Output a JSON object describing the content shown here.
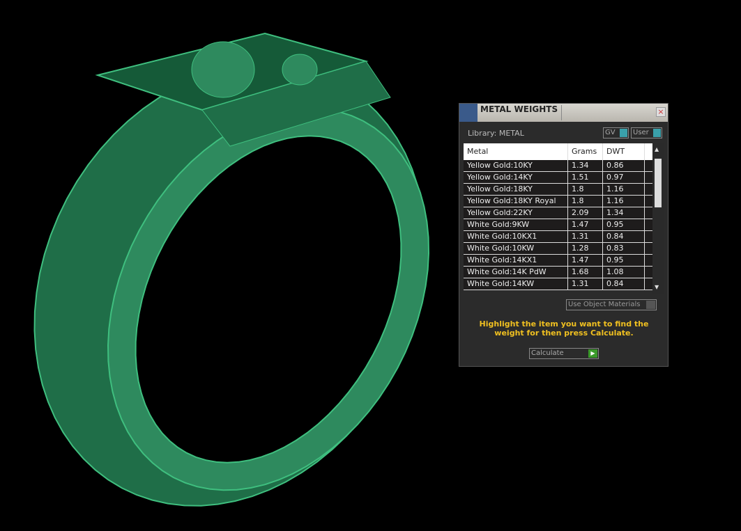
{
  "panel": {
    "title": "METAL WEIGHTS",
    "library_label": "Library: METAL",
    "toggles": [
      {
        "label": "GV"
      },
      {
        "label": "User"
      }
    ],
    "columns": [
      "Metal",
      "Grams",
      "DWT"
    ],
    "rows": [
      [
        "Yellow Gold:10KY",
        "1.34",
        "0.86"
      ],
      [
        "Yellow Gold:14KY",
        "1.51",
        "0.97"
      ],
      [
        "Yellow Gold:18KY",
        "1.8",
        "1.16"
      ],
      [
        "Yellow Gold:18KY Royal",
        "1.8",
        "1.16"
      ],
      [
        "Yellow Gold:22KY",
        "2.09",
        "1.34"
      ],
      [
        "White Gold:9KW",
        "1.47",
        "0.95"
      ],
      [
        "White Gold:10KX1",
        "1.31",
        "0.84"
      ],
      [
        "White Gold:10KW",
        "1.28",
        "0.83"
      ],
      [
        "White Gold:14KX1",
        "1.47",
        "0.95"
      ],
      [
        "White Gold:14K PdW",
        "1.68",
        "1.08"
      ],
      [
        "White Gold:14KW",
        "1.31",
        "0.84"
      ]
    ],
    "use_object_materials": "Use Object Materials",
    "message": "Highlight the item you want to find the weight for then press Calculate.",
    "calculate_label": "Calculate"
  },
  "colors": {
    "ring": "#2e8a5e",
    "message": "#f0c020"
  }
}
